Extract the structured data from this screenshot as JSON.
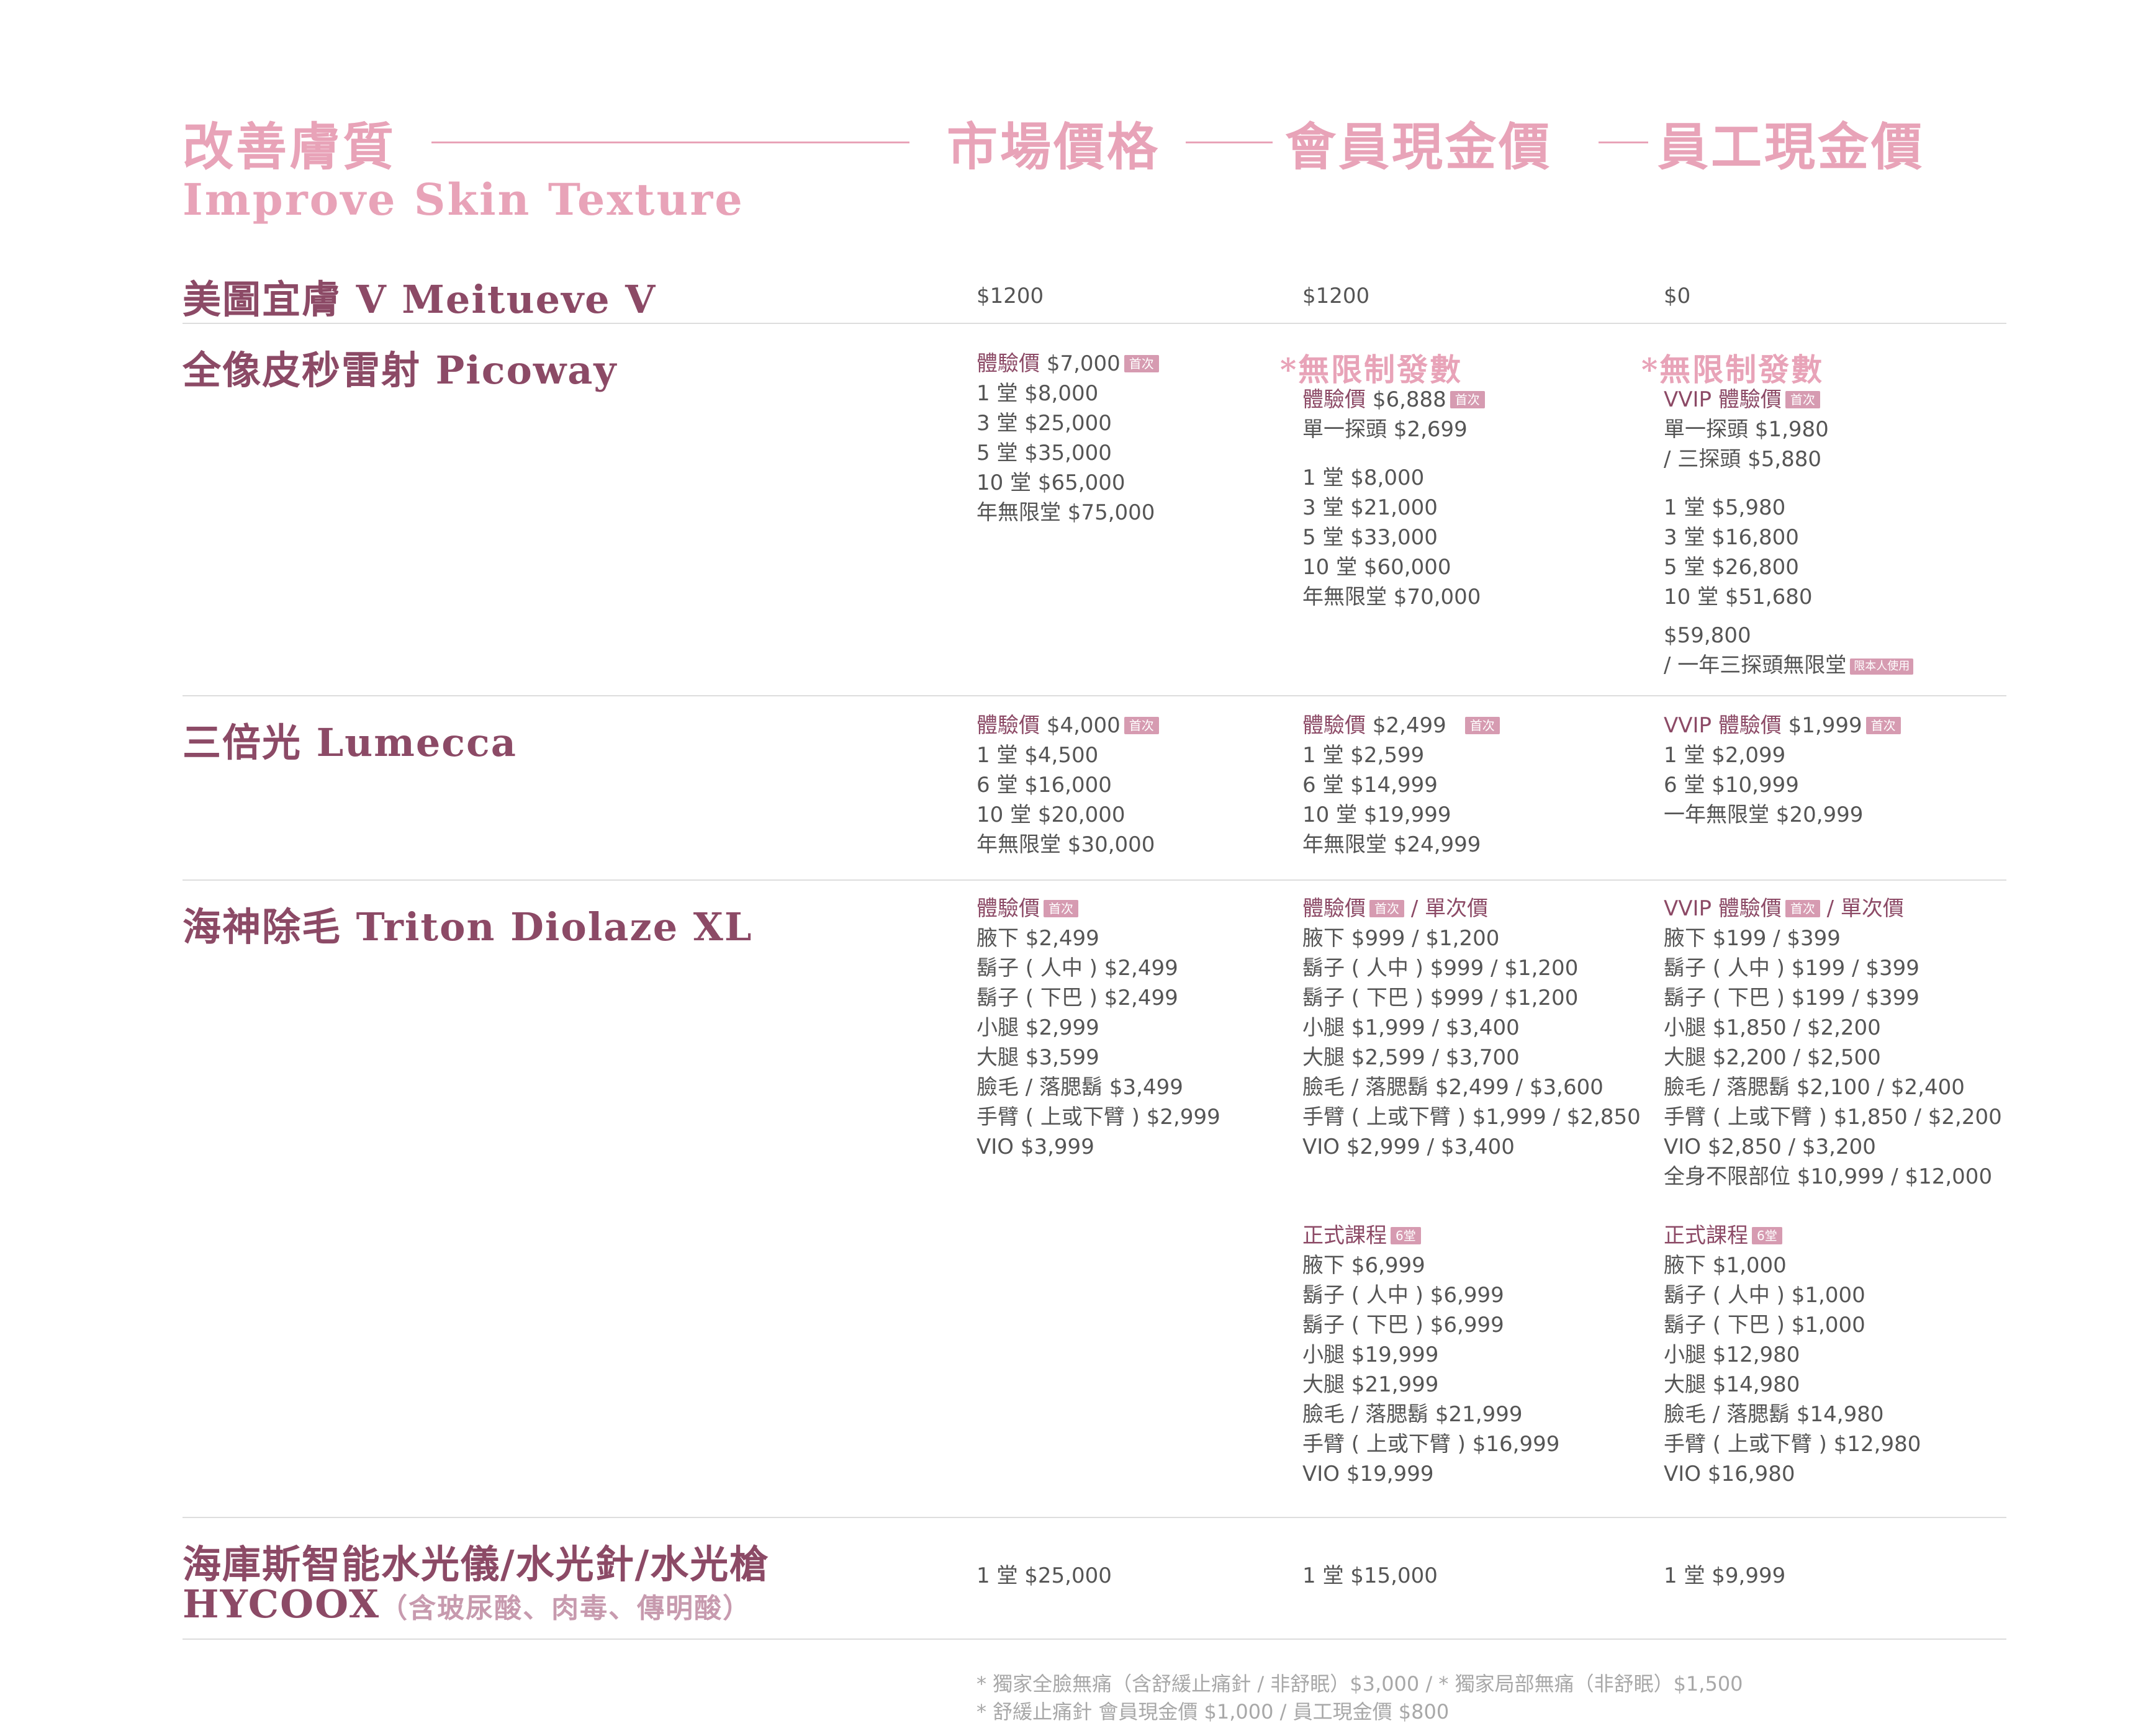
{
  "header": {
    "title_cn": "改善膚質",
    "title_en": "Improve Skin Texture",
    "col_market": "市場價格",
    "col_member": "會員現金價",
    "col_staff": "員工現金價"
  },
  "colors": {
    "accent_pink": "#e8a3b8",
    "plum": "#8c4a66",
    "tag": "#d69bb1",
    "body_text": "#555555"
  },
  "services": {
    "meitueve": {
      "name": "美圖宜膚 V Meitueve V",
      "market": [
        "$1200"
      ],
      "member": [
        "$1200"
      ],
      "staff": [
        "$0"
      ]
    },
    "picoway": {
      "name": "全像皮秒雷射 Picoway",
      "market": {
        "trial_label": "體驗價",
        "trial_price": "$7,000",
        "tag": "首次",
        "lines": [
          "1 堂 $8,000",
          "3 堂 $25,000",
          "5 堂 $35,000",
          "10 堂 $65,000",
          "年無限堂 $75,000"
        ]
      },
      "member": {
        "unlimited": "*無限制發數",
        "trial_label": "體驗價",
        "trial_price": "$6,888",
        "tag": "首次",
        "single": "單一探頭 $2,699",
        "lines": [
          "1 堂 $8,000",
          "3 堂 $21,000",
          "5 堂 $33,000",
          "10 堂 $60,000",
          "年無限堂 $70,000"
        ]
      },
      "staff": {
        "unlimited": "*無限制發數",
        "trial_label": "VVIP 體驗價",
        "tag": "首次",
        "single": "單一探頭 $1,980",
        "triple": "/ 三探頭 $5,880",
        "lines": [
          "1 堂 $5,980",
          "3 堂 $16,800",
          "5 堂 $26,800",
          "10 堂 $51,680"
        ],
        "year_price": "$59,800",
        "year_label": "/ 一年三探頭無限堂",
        "year_tag": "限本人使用"
      }
    },
    "lumecca": {
      "name": "三倍光 Lumecca",
      "market": {
        "trial_label": "體驗價",
        "trial_price": "$4,000",
        "tag": "首次",
        "lines": [
          "1 堂 $4,500",
          "6 堂 $16,000",
          "10 堂 $20,000",
          "年無限堂 $30,000"
        ]
      },
      "member": {
        "trial_label": "體驗價",
        "trial_price": "$2,499",
        "tag": "首次",
        "lines": [
          "1 堂 $2,599",
          "6 堂 $14,999",
          "10 堂 $19,999",
          "年無限堂 $24,999"
        ]
      },
      "staff": {
        "trial_label": "VVIP 體驗價",
        "trial_price": "$1,999",
        "tag": "首次",
        "lines": [
          "1 堂 $2,099",
          "6 堂 $10,999",
          "一年無限堂 $20,999"
        ]
      }
    },
    "triton": {
      "name": "海神除毛 Triton Diolaze XL",
      "market": {
        "trial_label": "體驗價",
        "tag": "首次",
        "lines": [
          "腋下 $2,499",
          "鬍子 ( 人中 ) $2,499",
          "鬍子 ( 下巴 ) $2,499",
          "小腿 $2,999",
          "大腿 $3,599",
          "臉毛 / 落腮鬍 $3,499",
          "手臂 ( 上或下臂 ) $2,999",
          "VIO $3,999"
        ]
      },
      "member": {
        "trial_label": "體驗價",
        "tag": "首次",
        "single_label": "/ 單次價",
        "lines": [
          "腋下 $999 / $1,200",
          "鬍子 ( 人中 ) $999 / $1,200",
          "鬍子 ( 下巴 ) $999 / $1,200",
          "小腿 $1,999 / $3,400",
          "大腿 $2,599 / $3,700",
          "臉毛 / 落腮鬍 $2,499 / $3,600",
          "手臂 ( 上或下臂 ) $1,999 / $2,850",
          "VIO $2,999 / $3,400"
        ],
        "course_label": "正式課程",
        "course_tag": "6堂",
        "course_lines": [
          "腋下 $6,999",
          "鬍子 ( 人中 ) $6,999",
          "鬍子 ( 下巴 ) $6,999",
          "小腿 $19,999",
          "大腿 $21,999",
          "臉毛 / 落腮鬍 $21,999",
          "手臂 ( 上或下臂 ) $16,999",
          "VIO $19,999"
        ]
      },
      "staff": {
        "trial_label": "VVIP 體驗價",
        "tag": "首次",
        "single_label": "/ 單次價",
        "lines": [
          "腋下 $199 / $399",
          "鬍子 ( 人中 ) $199 / $399",
          "鬍子 ( 下巴 ) $199 / $399",
          "小腿 $1,850 / $2,200",
          "大腿 $2,200 / $2,500",
          "臉毛 / 落腮鬍 $2,100 / $2,400",
          "手臂 ( 上或下臂 ) $1,850 / $2,200",
          "VIO $2,850 / $3,200",
          "全身不限部位 $10,999 / $12,000"
        ],
        "course_label": "正式課程",
        "course_tag": "6堂",
        "course_lines": [
          "腋下 $1,000",
          "鬍子 ( 人中 ) $1,000",
          "鬍子 ( 下巴 ) $1,000",
          "小腿 $12,980",
          "大腿 $14,980",
          "臉毛 / 落腮鬍 $14,980",
          "手臂 ( 上或下臂 ) $12,980",
          "VIO $16,980"
        ]
      }
    },
    "hycoox": {
      "name_line1": "海庫斯智能水光儀/水光針/水光槍",
      "name_line2": "HYCOOX",
      "name_sub": "（含玻尿酸、肉毒、傳明酸）",
      "market": "1 堂 $25,000",
      "member": "1 堂 $15,000",
      "staff": "1 堂 $9,999"
    }
  },
  "notes": {
    "line1": "* 獨家全臉無痛（含舒緩止痛針 / 非舒眠）$3,000 / * 獨家局部無痛（非舒眠）$1,500",
    "line2": "* 舒緩止痛針 會員現金價 $1,000 / 員工現金價 $800"
  }
}
